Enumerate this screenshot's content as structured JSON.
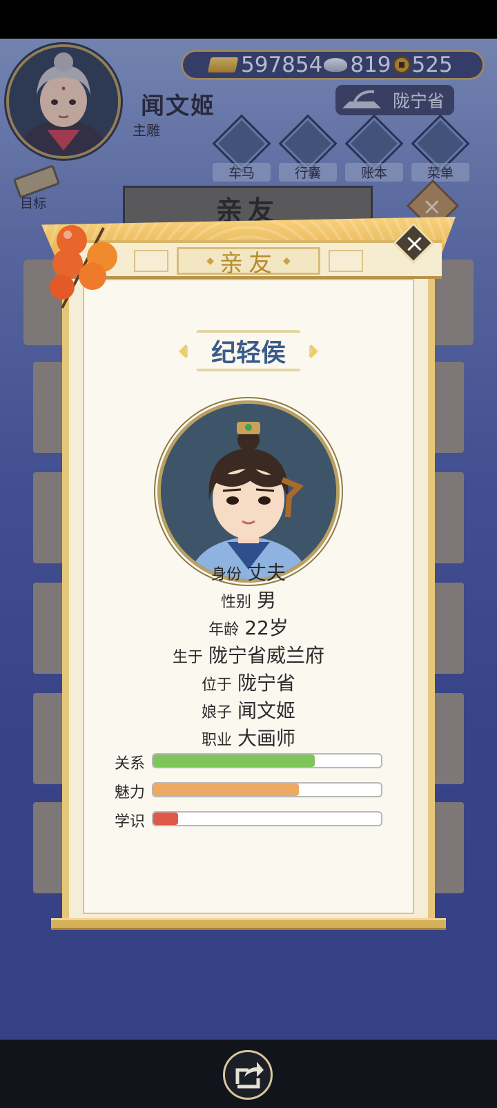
{
  "player": {
    "name": "闻文姬",
    "title": "主雕"
  },
  "resources": {
    "gold": "597854",
    "silver": "819",
    "coins": "525"
  },
  "location": "陇宁省",
  "nav": [
    {
      "label": "车马",
      "icon": "carriage-icon"
    },
    {
      "label": "行囊",
      "icon": "bag-icon"
    },
    {
      "label": "账本",
      "icon": "ledger-icon"
    },
    {
      "label": "菜单",
      "icon": "menu-dots-icon"
    }
  ],
  "goal_label": "目标",
  "background_panel_title": "亲友",
  "modal": {
    "title": "亲友",
    "character_name": "纪轻侯",
    "info": [
      {
        "key": "身份",
        "value": "丈夫"
      },
      {
        "key": "性别",
        "value": "男"
      },
      {
        "key": "年龄",
        "value": "22岁"
      },
      {
        "key": "生于",
        "value": "陇宁省威兰府"
      },
      {
        "key": "位于",
        "value": "陇宁省"
      },
      {
        "key": "娘子",
        "value": "闻文姬"
      },
      {
        "key": "职业",
        "value": "大画师"
      }
    ],
    "stats": [
      {
        "key": "关系",
        "level": 0.71,
        "color": "#7ec65a"
      },
      {
        "key": "魅力",
        "level": 0.64,
        "color": "#eea964"
      },
      {
        "key": "学识",
        "level": 0.11,
        "color": "#e0584a"
      }
    ]
  },
  "colors": {
    "accent_gold": "#c7a862",
    "name_blue": "#3a5b8c",
    "scene_blue": "#4d5da6"
  }
}
